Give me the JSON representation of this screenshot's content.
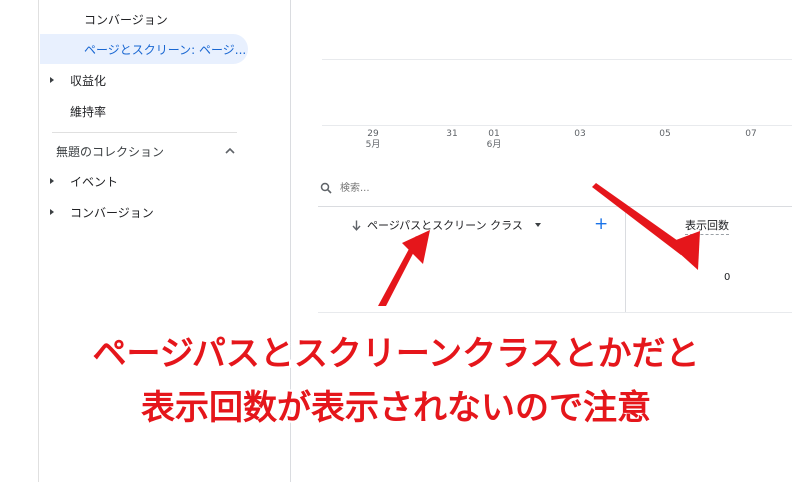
{
  "sidebar": {
    "items": [
      {
        "label": "コンバージョン"
      },
      {
        "label": "ページとスクリーン: ページ..."
      },
      {
        "label": "収益化"
      },
      {
        "label": "維持率"
      }
    ],
    "collection": {
      "title": "無題のコレクション",
      "items": [
        {
          "label": "イベント"
        },
        {
          "label": "コンバージョン"
        }
      ]
    }
  },
  "chart": {
    "x_ticks": [
      {
        "day": "29",
        "month": "5月"
      },
      {
        "day": "31",
        "month": ""
      },
      {
        "day": "01",
        "month": "6月"
      },
      {
        "day": "03",
        "month": ""
      },
      {
        "day": "05",
        "month": ""
      },
      {
        "day": "07",
        "month": ""
      }
    ]
  },
  "table": {
    "search_placeholder": "検索...",
    "dimension_header": "ページパスとスクリーン クラス",
    "add_label": "+",
    "metric_header": "表示回数",
    "metric_value": "0"
  },
  "annotation": {
    "line1": "ページパスとスクリーンクラスとかだと",
    "line2": "表示回数が表示されないので注意",
    "arrow_color": "#e5161b"
  }
}
